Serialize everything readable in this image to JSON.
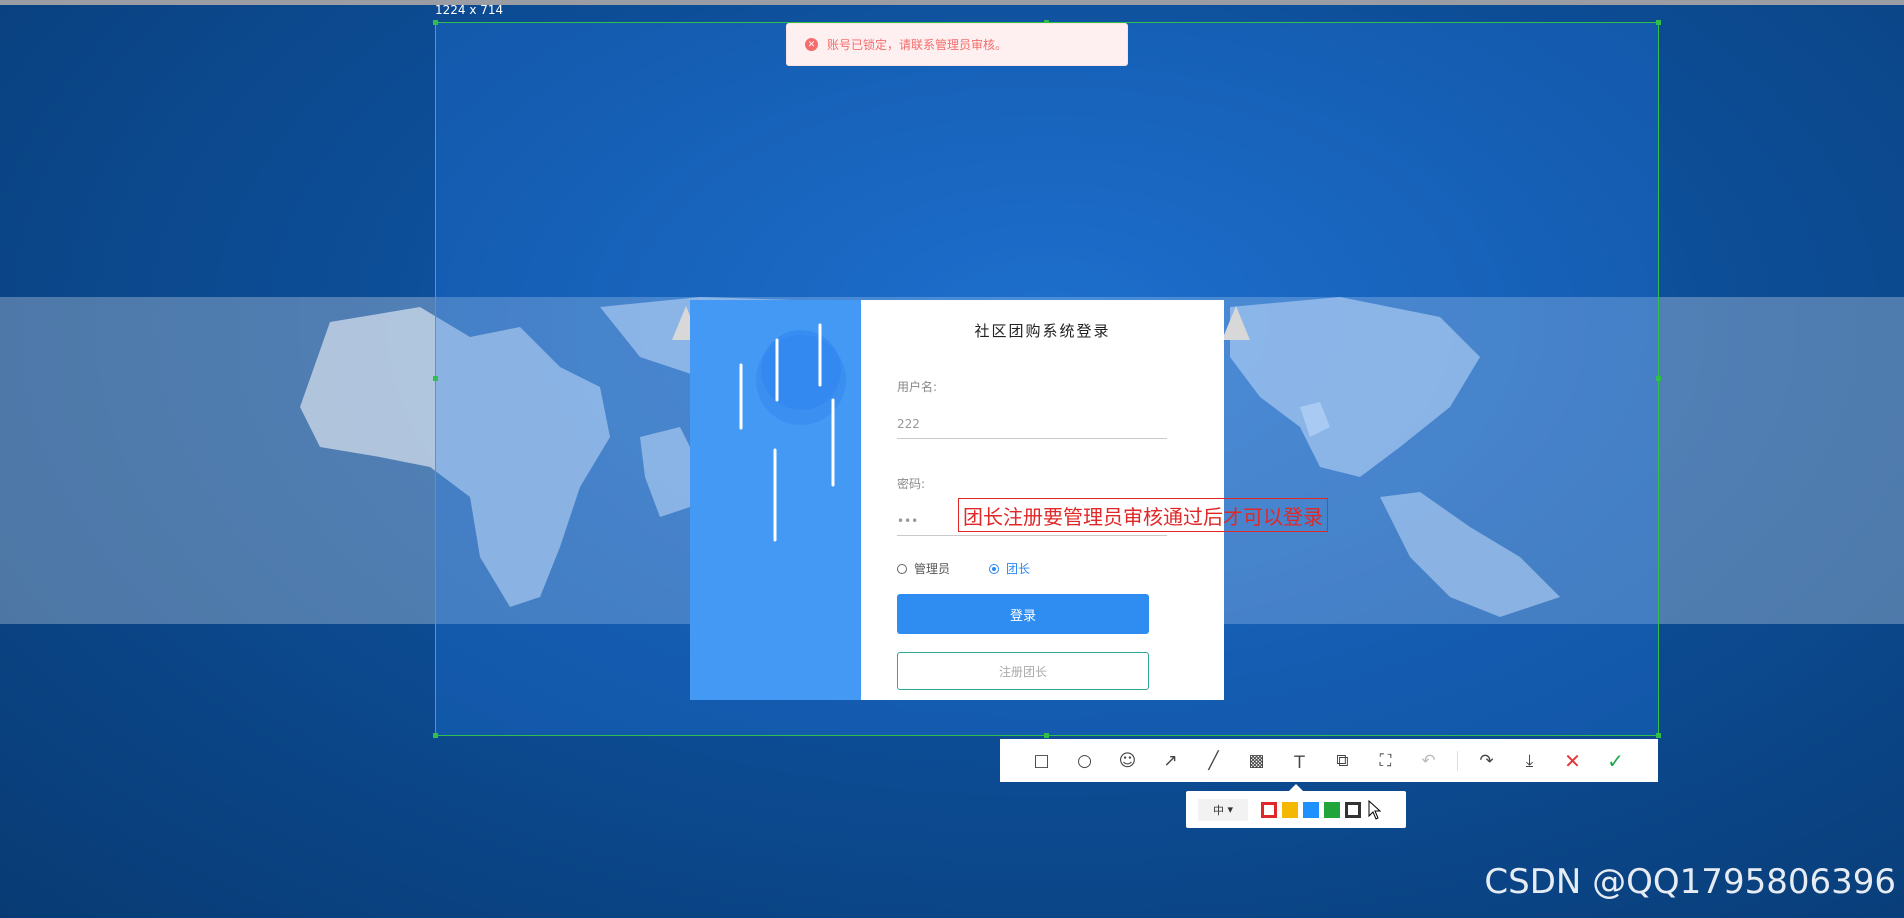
{
  "screenshot_tool": {
    "selection_size": "1224 x 714",
    "toolbar_icons": [
      "rectangle-icon",
      "ellipse-icon",
      "emoji-icon",
      "arrow-icon",
      "line-icon",
      "mosaic-icon",
      "text-icon",
      "copy-icon",
      "ocr-icon",
      "undo-icon",
      "share-icon",
      "save-icon",
      "cancel-icon",
      "confirm-icon"
    ],
    "size_option": "中",
    "colors": [
      "#e02828",
      "#f5b800",
      "#1e90ff",
      "#21a43a",
      "#333333"
    ],
    "selected_color": "#333333"
  },
  "toast": {
    "message": "账号已锁定，请联系管理员审核。",
    "color": "#f56c6c"
  },
  "login": {
    "title": "社区团购系统登录",
    "username_label": "用户名:",
    "username_value": "222",
    "password_label": "密码:",
    "password_value": "•••",
    "role_admin": "管理员",
    "role_leader": "团长",
    "selected_role": "团长",
    "login_button": "登录",
    "register_button": "注册团长",
    "accent": "#2f8cf0"
  },
  "annotation": {
    "text": "团长注册要管理员审核通过后才可以登录"
  },
  "watermark": "CSDN @QQ1795806396"
}
